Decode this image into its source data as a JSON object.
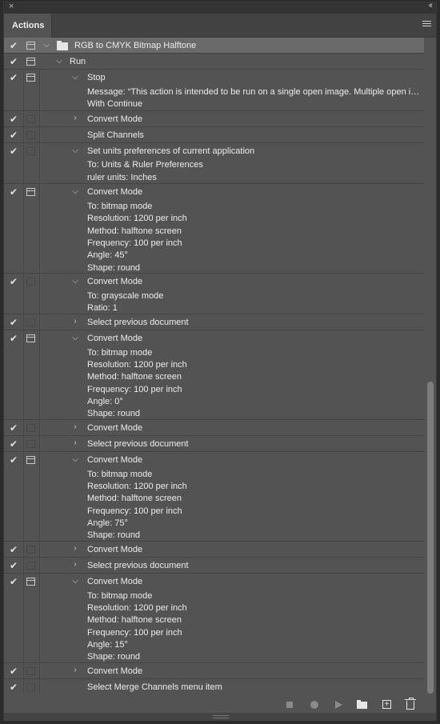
{
  "panel": {
    "tab_label": "Actions",
    "close_glyph": "×",
    "collapse_glyph": "‹‹"
  },
  "set": {
    "name": "RGB to CMYK Bitmap Halftone"
  },
  "action": {
    "name": "Run"
  },
  "steps": [
    {
      "label": "Stop",
      "details": [
        "Message:  “This action is intended to be run on a single open image. Multiple open im…",
        "With Continue"
      ]
    },
    {
      "label": "Convert Mode",
      "details": []
    },
    {
      "label": "Split Channels",
      "details": []
    },
    {
      "label": "Set units preferences of current application",
      "details": [
        "To: Units & Ruler Preferences",
        "ruler units: Inches"
      ]
    },
    {
      "label": "Convert Mode",
      "details": [
        "To: bitmap mode",
        "Resolution: 1200 per inch",
        "Method: halftone screen",
        "Frequency: 100 per inch",
        "Angle: 45°",
        "Shape: round"
      ]
    },
    {
      "label": "Convert Mode",
      "details": [
        "To: grayscale mode",
        "Ratio: 1"
      ]
    },
    {
      "label": "Select previous document",
      "details": []
    },
    {
      "label": "Convert Mode",
      "details": [
        "To: bitmap mode",
        "Resolution: 1200 per inch",
        "Method: halftone screen",
        "Frequency: 100 per inch",
        "Angle: 0°",
        "Shape: round"
      ]
    },
    {
      "label": "Convert Mode",
      "details": []
    },
    {
      "label": "Select previous document",
      "details": []
    },
    {
      "label": "Convert Mode",
      "details": [
        "To: bitmap mode",
        "Resolution: 1200 per inch",
        "Method: halftone screen",
        "Frequency: 100 per inch",
        "Angle: 75°",
        "Shape: round"
      ]
    },
    {
      "label": "Convert Mode",
      "details": []
    },
    {
      "label": "Select previous document",
      "details": []
    },
    {
      "label": "Convert Mode",
      "details": [
        "To: bitmap mode",
        "Resolution: 1200 per inch",
        "Method: halftone screen",
        "Frequency: 100 per inch",
        "Angle: 15°",
        "Shape: round"
      ]
    },
    {
      "label": "Convert Mode",
      "details": []
    },
    {
      "label": "Select Merge Channels menu item",
      "details": []
    }
  ],
  "footer": {
    "icons": [
      "stop-icon",
      "record-icon",
      "play-icon",
      "new-set-icon",
      "new-action-icon",
      "delete-icon"
    ]
  }
}
